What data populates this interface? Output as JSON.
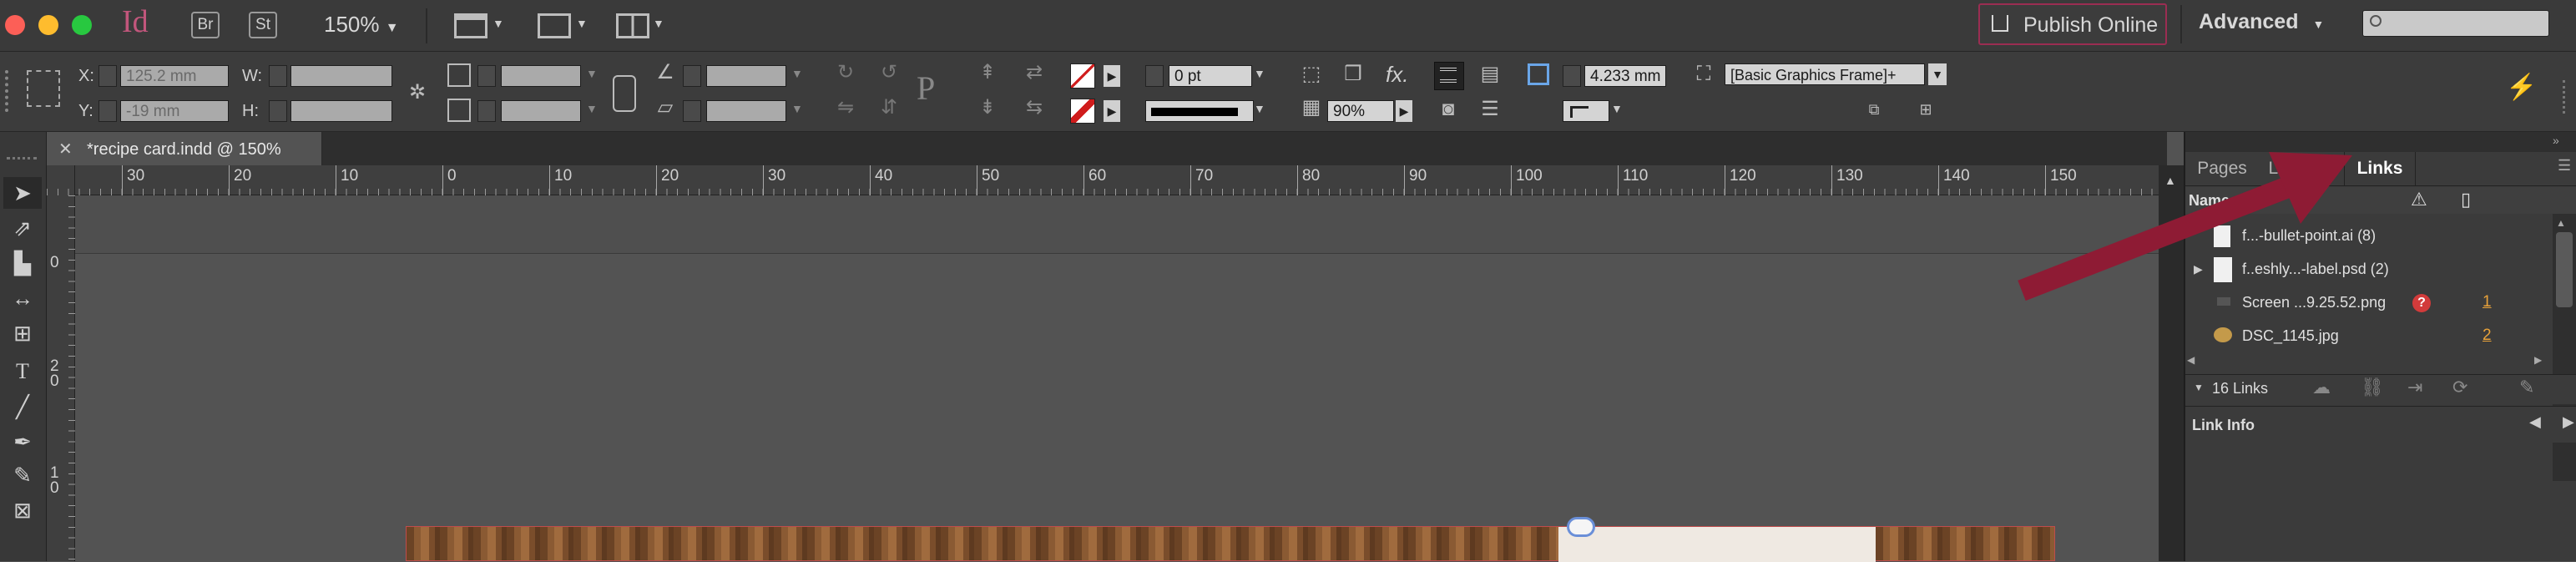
{
  "app": {
    "logo": "Id",
    "bridge_label": "Br",
    "stock_label": "St",
    "zoom": "150%"
  },
  "titlebar": {
    "publish_label": "Publish Online",
    "workspace_label": "Advanced"
  },
  "control": {
    "x_label": "X:",
    "x_value": "125.2 mm",
    "y_label": "Y:",
    "y_value": "-19 mm",
    "w_label": "W:",
    "h_label": "H:",
    "stroke_value": "0 pt",
    "opacity_value": "90%",
    "fx_label": "fx.",
    "offset_value": "4.233 mm",
    "frame_style": "[Basic Graphics Frame]+",
    "corner_P": "P"
  },
  "document": {
    "tab_title": "*recipe card.indd @ 150%"
  },
  "ruler": {
    "h_ticks": [
      "30",
      "20",
      "10",
      "0",
      "10",
      "20",
      "30",
      "40",
      "50",
      "60",
      "70",
      "80",
      "90",
      "100",
      "110",
      "120",
      "130",
      "140",
      "150"
    ],
    "v_ticks": [
      "0",
      "2\n0",
      "1\n0"
    ]
  },
  "panel": {
    "tabs": [
      "Pages",
      "Layers",
      "Links"
    ],
    "active_tab": "Links",
    "name_header": "Name",
    "links": [
      {
        "name": "f...-bullet-point.ai (8)",
        "page": ""
      },
      {
        "name": "f..eshly...-label.psd (2)",
        "page": ""
      },
      {
        "name": "Screen ...9.25.52.png",
        "page": "1"
      },
      {
        "name": "DSC_1145.jpg",
        "page": "2"
      }
    ],
    "links_count": "16 Links",
    "link_info_label": "Link Info"
  },
  "colors": {
    "accent": "#d6336c",
    "arrow": "#8e1b34",
    "publish_border": "#9b2d52"
  }
}
